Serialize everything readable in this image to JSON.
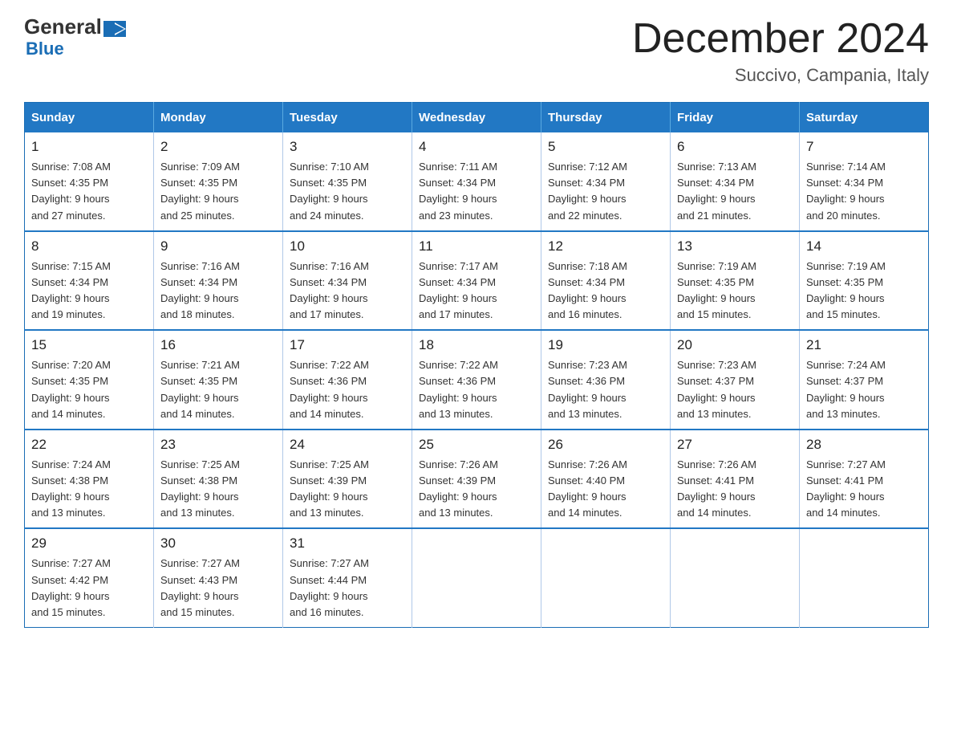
{
  "header": {
    "logo_general": "General",
    "logo_blue": "Blue",
    "month_title": "December 2024",
    "location": "Succivo, Campania, Italy"
  },
  "days_of_week": [
    "Sunday",
    "Monday",
    "Tuesday",
    "Wednesday",
    "Thursday",
    "Friday",
    "Saturday"
  ],
  "weeks": [
    [
      {
        "day": "1",
        "sunrise": "7:08 AM",
        "sunset": "4:35 PM",
        "daylight": "9 hours and 27 minutes."
      },
      {
        "day": "2",
        "sunrise": "7:09 AM",
        "sunset": "4:35 PM",
        "daylight": "9 hours and 25 minutes."
      },
      {
        "day": "3",
        "sunrise": "7:10 AM",
        "sunset": "4:35 PM",
        "daylight": "9 hours and 24 minutes."
      },
      {
        "day": "4",
        "sunrise": "7:11 AM",
        "sunset": "4:34 PM",
        "daylight": "9 hours and 23 minutes."
      },
      {
        "day": "5",
        "sunrise": "7:12 AM",
        "sunset": "4:34 PM",
        "daylight": "9 hours and 22 minutes."
      },
      {
        "day": "6",
        "sunrise": "7:13 AM",
        "sunset": "4:34 PM",
        "daylight": "9 hours and 21 minutes."
      },
      {
        "day": "7",
        "sunrise": "7:14 AM",
        "sunset": "4:34 PM",
        "daylight": "9 hours and 20 minutes."
      }
    ],
    [
      {
        "day": "8",
        "sunrise": "7:15 AM",
        "sunset": "4:34 PM",
        "daylight": "9 hours and 19 minutes."
      },
      {
        "day": "9",
        "sunrise": "7:16 AM",
        "sunset": "4:34 PM",
        "daylight": "9 hours and 18 minutes."
      },
      {
        "day": "10",
        "sunrise": "7:16 AM",
        "sunset": "4:34 PM",
        "daylight": "9 hours and 17 minutes."
      },
      {
        "day": "11",
        "sunrise": "7:17 AM",
        "sunset": "4:34 PM",
        "daylight": "9 hours and 17 minutes."
      },
      {
        "day": "12",
        "sunrise": "7:18 AM",
        "sunset": "4:34 PM",
        "daylight": "9 hours and 16 minutes."
      },
      {
        "day": "13",
        "sunrise": "7:19 AM",
        "sunset": "4:35 PM",
        "daylight": "9 hours and 15 minutes."
      },
      {
        "day": "14",
        "sunrise": "7:19 AM",
        "sunset": "4:35 PM",
        "daylight": "9 hours and 15 minutes."
      }
    ],
    [
      {
        "day": "15",
        "sunrise": "7:20 AM",
        "sunset": "4:35 PM",
        "daylight": "9 hours and 14 minutes."
      },
      {
        "day": "16",
        "sunrise": "7:21 AM",
        "sunset": "4:35 PM",
        "daylight": "9 hours and 14 minutes."
      },
      {
        "day": "17",
        "sunrise": "7:22 AM",
        "sunset": "4:36 PM",
        "daylight": "9 hours and 14 minutes."
      },
      {
        "day": "18",
        "sunrise": "7:22 AM",
        "sunset": "4:36 PM",
        "daylight": "9 hours and 13 minutes."
      },
      {
        "day": "19",
        "sunrise": "7:23 AM",
        "sunset": "4:36 PM",
        "daylight": "9 hours and 13 minutes."
      },
      {
        "day": "20",
        "sunrise": "7:23 AM",
        "sunset": "4:37 PM",
        "daylight": "9 hours and 13 minutes."
      },
      {
        "day": "21",
        "sunrise": "7:24 AM",
        "sunset": "4:37 PM",
        "daylight": "9 hours and 13 minutes."
      }
    ],
    [
      {
        "day": "22",
        "sunrise": "7:24 AM",
        "sunset": "4:38 PM",
        "daylight": "9 hours and 13 minutes."
      },
      {
        "day": "23",
        "sunrise": "7:25 AM",
        "sunset": "4:38 PM",
        "daylight": "9 hours and 13 minutes."
      },
      {
        "day": "24",
        "sunrise": "7:25 AM",
        "sunset": "4:39 PM",
        "daylight": "9 hours and 13 minutes."
      },
      {
        "day": "25",
        "sunrise": "7:26 AM",
        "sunset": "4:39 PM",
        "daylight": "9 hours and 13 minutes."
      },
      {
        "day": "26",
        "sunrise": "7:26 AM",
        "sunset": "4:40 PM",
        "daylight": "9 hours and 14 minutes."
      },
      {
        "day": "27",
        "sunrise": "7:26 AM",
        "sunset": "4:41 PM",
        "daylight": "9 hours and 14 minutes."
      },
      {
        "day": "28",
        "sunrise": "7:27 AM",
        "sunset": "4:41 PM",
        "daylight": "9 hours and 14 minutes."
      }
    ],
    [
      {
        "day": "29",
        "sunrise": "7:27 AM",
        "sunset": "4:42 PM",
        "daylight": "9 hours and 15 minutes."
      },
      {
        "day": "30",
        "sunrise": "7:27 AM",
        "sunset": "4:43 PM",
        "daylight": "9 hours and 15 minutes."
      },
      {
        "day": "31",
        "sunrise": "7:27 AM",
        "sunset": "4:44 PM",
        "daylight": "9 hours and 16 minutes."
      },
      null,
      null,
      null,
      null
    ]
  ]
}
